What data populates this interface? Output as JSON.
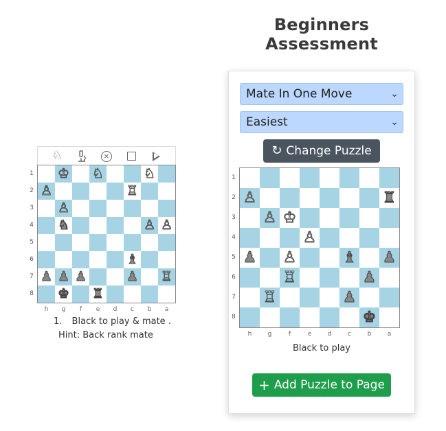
{
  "page": {
    "title": "Beginners Assessment"
  },
  "preview": {
    "toolbar": {
      "icons": [
        "knight-icon",
        "microscope-icon",
        "circle-x-icon",
        "stop-icon",
        "play-icon"
      ]
    },
    "board": {
      "ranks": [
        "1",
        "2",
        "3",
        "4",
        "5",
        "6",
        "7",
        "8"
      ],
      "files": [
        "h",
        "g",
        "f",
        "e",
        "d",
        "c",
        "b",
        "a"
      ],
      "pieces": [
        {
          "sq": "g1",
          "p": "♔",
          "c": "w"
        },
        {
          "sq": "e1",
          "p": "♘",
          "c": "w"
        },
        {
          "sq": "b1",
          "p": "♘",
          "c": "w"
        },
        {
          "sq": "h2",
          "p": "♙",
          "c": "w"
        },
        {
          "sq": "c2",
          "p": "♖",
          "c": "w"
        },
        {
          "sq": "g3",
          "p": "♙",
          "c": "w"
        },
        {
          "sq": "g4",
          "p": "♞",
          "c": "b"
        },
        {
          "sq": "b4",
          "p": "♙",
          "c": "w"
        },
        {
          "sq": "a4",
          "p": "♙",
          "c": "w"
        },
        {
          "sq": "c6",
          "p": "♝",
          "c": "b"
        },
        {
          "sq": "h7",
          "p": "♟",
          "c": "b"
        },
        {
          "sq": "g7",
          "p": "♟",
          "c": "b"
        },
        {
          "sq": "f7",
          "p": "♟",
          "c": "b"
        },
        {
          "sq": "c7",
          "p": "♟",
          "c": "b"
        },
        {
          "sq": "a7",
          "p": "♖",
          "c": "w"
        },
        {
          "sq": "g8",
          "p": "♚",
          "c": "b"
        },
        {
          "sq": "e8",
          "p": "♜",
          "c": "b"
        }
      ]
    },
    "caption_number": "1.",
    "caption": "Black to play & mate .",
    "hint": "Hint: Back rank mate"
  },
  "panel": {
    "puzzle_type": {
      "selected": "Mate In One Move"
    },
    "difficulty": {
      "selected": "Easiest"
    },
    "change_button": "Change Puzzle",
    "board": {
      "ranks": [
        "1",
        "2",
        "3",
        "4",
        "5",
        "6",
        "7",
        "8"
      ],
      "files": [
        "h",
        "g",
        "f",
        "e",
        "d",
        "c",
        "b",
        "a"
      ],
      "pieces": [
        {
          "sq": "h2",
          "p": "♙",
          "c": "w"
        },
        {
          "sq": "a2",
          "p": "♜",
          "c": "b"
        },
        {
          "sq": "g3",
          "p": "♙",
          "c": "w"
        },
        {
          "sq": "f3",
          "p": "♔",
          "c": "w"
        },
        {
          "sq": "e4",
          "p": "♙",
          "c": "w"
        },
        {
          "sq": "h5",
          "p": "♟",
          "c": "b"
        },
        {
          "sq": "f5",
          "p": "♙",
          "c": "w"
        },
        {
          "sq": "c5",
          "p": "♝",
          "c": "b"
        },
        {
          "sq": "a5",
          "p": "♟",
          "c": "b"
        },
        {
          "sq": "f6",
          "p": "♖",
          "c": "w"
        },
        {
          "sq": "b6",
          "p": "♟",
          "c": "b"
        },
        {
          "sq": "g7",
          "p": "♖",
          "c": "w"
        },
        {
          "sq": "c7",
          "p": "♟",
          "c": "b"
        },
        {
          "sq": "b8",
          "p": "♚",
          "c": "b"
        }
      ]
    },
    "status": "Black to play",
    "add_button": "Add Puzzle to Page"
  },
  "colors": {
    "light": "#ffffff",
    "dark": "#a6d4e4",
    "select_bg": "#bcd8ff",
    "change_btn": "#4b5560",
    "add_btn": "#1e9e4a"
  }
}
